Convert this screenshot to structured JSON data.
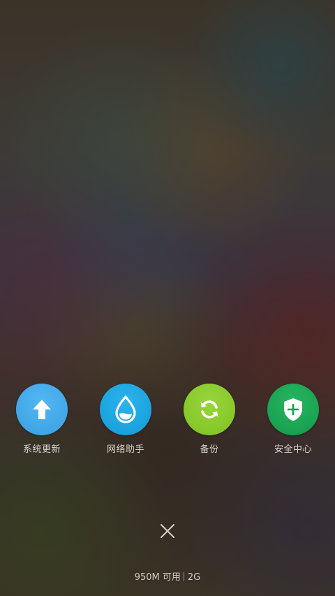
{
  "shortcuts": [
    {
      "label": "系统更新",
      "icon": "arrow-up-icon",
      "color": "#3fa7e8"
    },
    {
      "label": "网络助手",
      "icon": "water-drop-icon",
      "color": "#1aa3e0"
    },
    {
      "label": "备份",
      "icon": "sync-icon",
      "color": "#86c92a"
    },
    {
      "label": "安全中心",
      "icon": "shield-plus-icon",
      "color": "#1aa454"
    }
  ],
  "close": {
    "icon": "close-icon"
  },
  "memory": {
    "available": "950M 可用",
    "total": "2G"
  }
}
